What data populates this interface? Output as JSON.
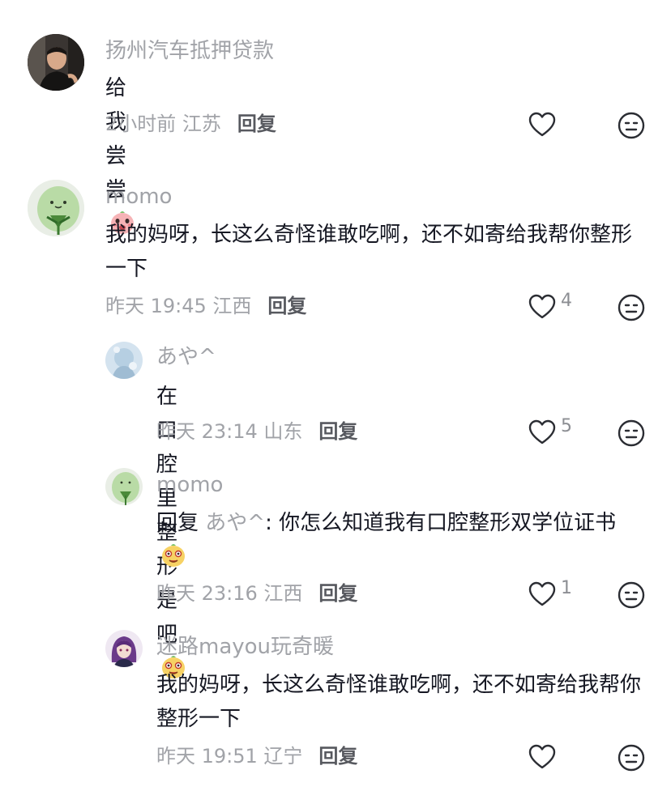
{
  "comments": [
    {
      "username": "扬州汽车抵押贷款",
      "text": "给我尝尝",
      "time_location": "2小时前 江苏",
      "reply_label": "回复",
      "likes": "",
      "emoji": "pink-blushing-emoji"
    },
    {
      "username": "momo",
      "text": "我的妈呀，长这么奇怪谁敢吃啊，还不如寄给我帮你整形一下",
      "time_location": "昨天 19:45 江西",
      "reply_label": "回复",
      "likes": "4"
    },
    {
      "username": "あや^",
      "text": "在口腔里整形是吧",
      "time_location": "昨天 23:14 山东",
      "reply_label": "回复",
      "likes": "5",
      "emoji": "yellow-face-emoji"
    },
    {
      "username": "momo",
      "reply_prefix": "回复",
      "reply_to": "あや^",
      "text": ": 你怎么知道我有口腔整形双学位证书",
      "time_location": "昨天 23:16 江西",
      "reply_label": "回复",
      "likes": "1",
      "emoji": "yellow-face-emoji"
    },
    {
      "username": "迷路mayou玩奇暖",
      "text": "我的妈呀，长这么奇怪谁敢吃啊，还不如寄给我帮你整形一下",
      "time_location": "昨天 19:51 辽宁",
      "reply_label": "回复",
      "likes": ""
    }
  ],
  "colors": {
    "text": "#161823",
    "meta": "#a1a3a8",
    "icon": "#2b2d33"
  }
}
